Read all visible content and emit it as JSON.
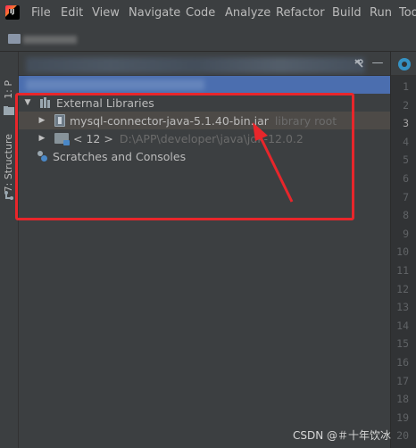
{
  "menu": {
    "logo_letter": "IJ",
    "items": [
      "File",
      "Edit",
      "View",
      "Navigate",
      "Code",
      "Analyze",
      "Refactor",
      "Build",
      "Run",
      "Too"
    ]
  },
  "left_stripe": {
    "project_tab": "1: P",
    "structure_tab": "7: Structure"
  },
  "panel_header": {
    "hide_button": "—"
  },
  "tree": {
    "external_libraries": "External Libraries",
    "jar_name": "mysql-connector-java-5.1.40-bin.jar",
    "jar_hint": "library root",
    "jdk_name": "< 12 >",
    "jdk_path": "D:\\APP\\developer\\java\\jdk-12.0.2",
    "scratches": "Scratches and Consoles"
  },
  "editor": {
    "line_numbers": [
      "1",
      "2",
      "3",
      "4",
      "5",
      "6",
      "7",
      "8",
      "9",
      "10",
      "11",
      "12",
      "13",
      "14",
      "15",
      "16",
      "17",
      "18",
      "19",
      "20"
    ],
    "current_line": "3"
  },
  "watermark": "CSDN @＃十年饮冰",
  "colors": {
    "highlight_red": "#e8262b",
    "selection_blue": "#4b6eaf"
  }
}
